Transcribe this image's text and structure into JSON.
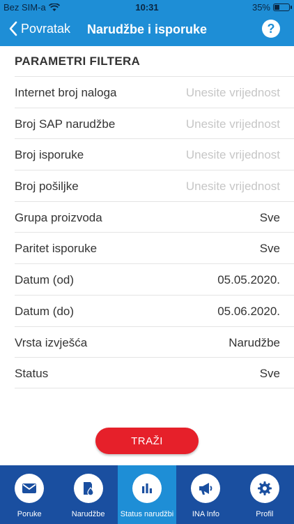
{
  "statusbar": {
    "carrier": "Bez SIM-a",
    "time": "10:31",
    "battery": "35%"
  },
  "navbar": {
    "back_label": "Povratak",
    "title": "Narudžbe i isporuke",
    "help": "?"
  },
  "section_title": "PARAMETRI FILTERA",
  "fields": [
    {
      "label": "Internet broj naloga",
      "value": "",
      "placeholder": "Unesite vrijednost"
    },
    {
      "label": "Broj SAP narudžbe",
      "value": "",
      "placeholder": "Unesite vrijednost"
    },
    {
      "label": "Broj isporuke",
      "value": "",
      "placeholder": "Unesite vrijednost"
    },
    {
      "label": "Broj pošiljke",
      "value": "",
      "placeholder": "Unesite vrijednost"
    },
    {
      "label": "Grupa proizvoda",
      "value": "Sve"
    },
    {
      "label": "Paritet isporuke",
      "value": "Sve"
    },
    {
      "label": "Datum (od)",
      "value": "05.05.2020."
    },
    {
      "label": "Datum (do)",
      "value": "05.06.2020."
    },
    {
      "label": "Vrsta izvješća",
      "value": "Narudžbe"
    },
    {
      "label": "Status",
      "value": "Sve"
    }
  ],
  "search_button": "TRAŽI",
  "tabs": [
    {
      "label": "Poruke",
      "icon": "envelope-icon"
    },
    {
      "label": "Narudžbe",
      "icon": "fuel-drop-icon"
    },
    {
      "label": "Status narudžbi",
      "icon": "bar-chart-icon",
      "active": true
    },
    {
      "label": "INA Info",
      "icon": "megaphone-icon"
    },
    {
      "label": "Profil",
      "icon": "gear-icon"
    }
  ],
  "colors": {
    "primary": "#1e8ed6",
    "tabbar": "#1a4fa0",
    "accent": "#e6202a"
  }
}
